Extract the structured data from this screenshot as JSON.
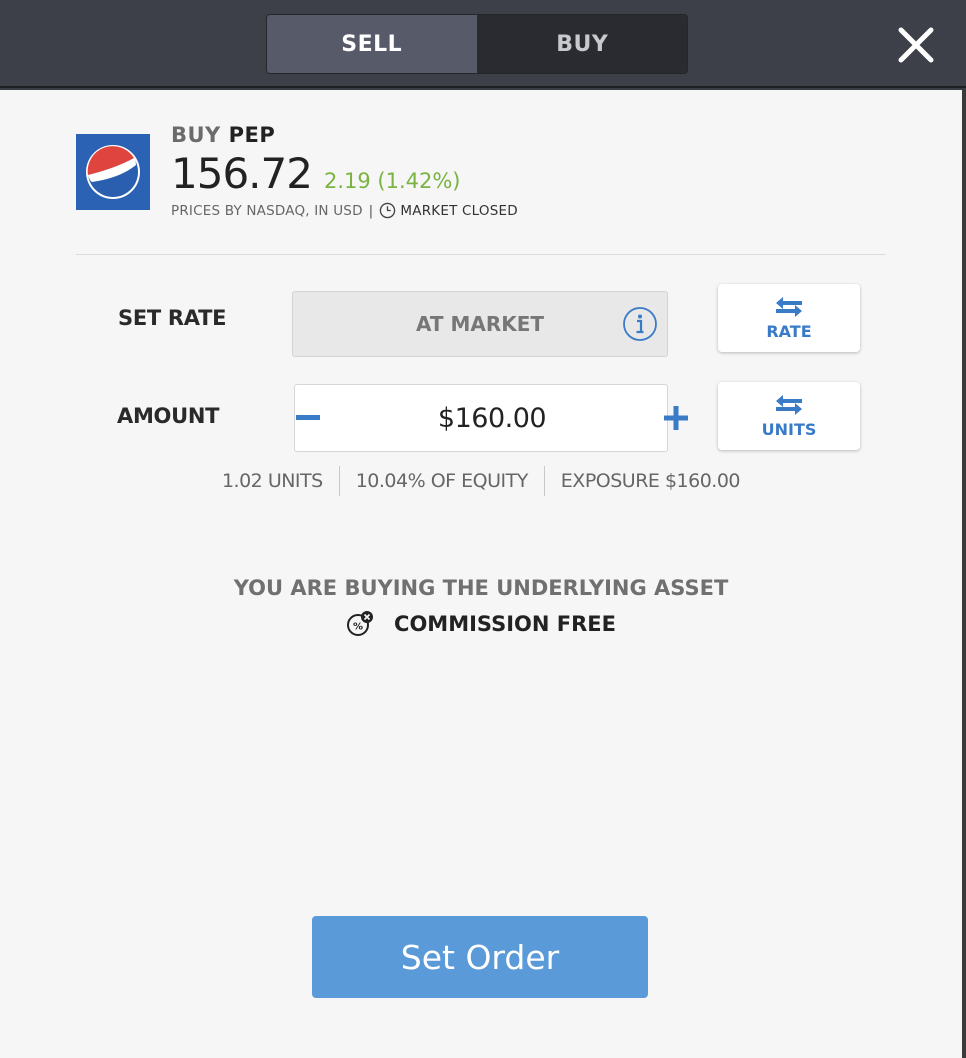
{
  "topbar": {
    "tabs": [
      {
        "label": "SELL",
        "active": true
      },
      {
        "label": "BUY",
        "active": false
      }
    ],
    "close_icon": "close-icon"
  },
  "instrument": {
    "action": "BUY",
    "ticker": "PEP",
    "logo": "pepsi-logo",
    "price": "156.72",
    "change": "2.19 (1.42%)",
    "change_color": "#7ab342",
    "source": "PRICES BY NASDAQ, IN USD",
    "separator": "|",
    "market_status": "MARKET CLOSED"
  },
  "rate": {
    "label": "SET RATE",
    "value": "AT MARKET",
    "info_icon": "info-icon",
    "switch_label": "RATE"
  },
  "amount": {
    "label": "AMOUNT",
    "value": "$160.00",
    "minus_icon": "minus-icon",
    "plus_icon": "plus-icon",
    "switch_label": "UNITS"
  },
  "stats": {
    "units": "1.02 UNITS",
    "equity": "10.04% OF EQUITY",
    "exposure": "EXPOSURE $160.00"
  },
  "notice": {
    "line1": "YOU ARE BUYING THE UNDERLYING ASSET",
    "line2": "COMMISSION FREE"
  },
  "submit": {
    "label": "Set Order",
    "color": "#5a9ad8"
  },
  "colors": {
    "accent": "#3a7bc8",
    "topbar": "#3e4049"
  }
}
